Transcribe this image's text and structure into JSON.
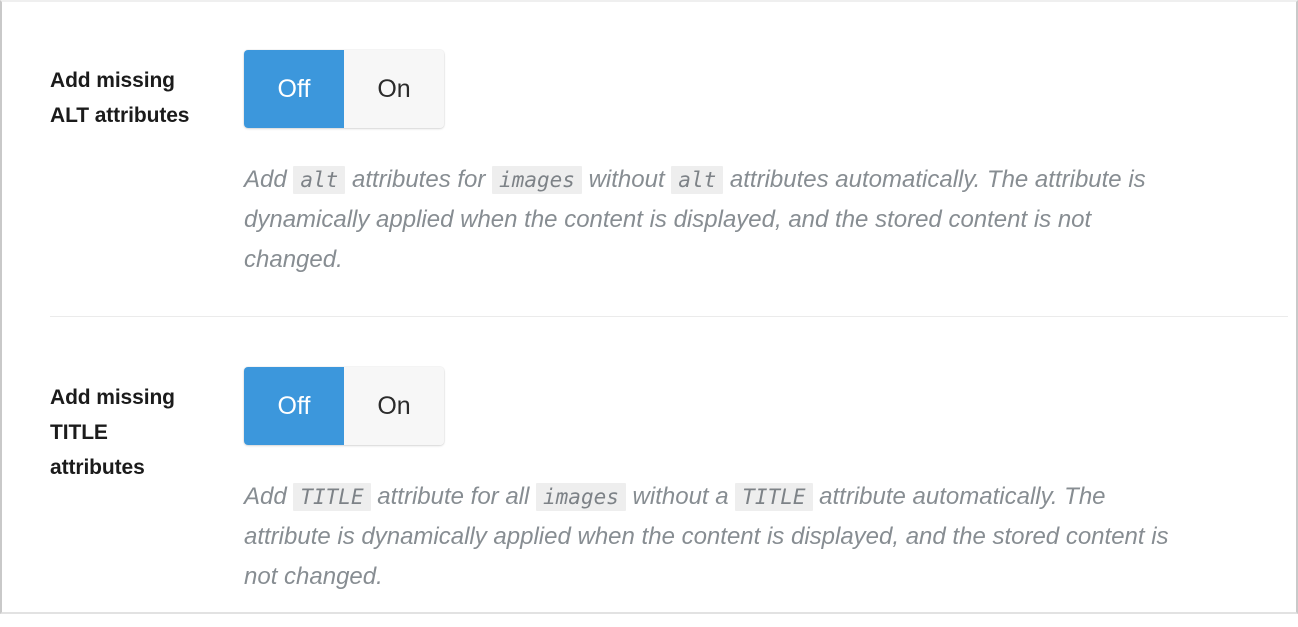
{
  "colors": {
    "accent": "#3c97dc",
    "accent_text": "#ffffff",
    "segment_inactive_bg": "#f7f7f7",
    "segment_inactive_text": "#2b2b2b",
    "label_text": "#1b1b1b",
    "description_text": "#878d92",
    "code_bg": "#eeeeee",
    "divider": "#ebebeb",
    "page_bg": "#ffffff"
  },
  "settings": [
    {
      "label": "Add missing ALT attributes",
      "toggle": {
        "off_label": "Off",
        "on_label": "On",
        "selected": "Off"
      },
      "description": {
        "parts": [
          {
            "type": "text",
            "value": "Add "
          },
          {
            "type": "code",
            "value": "alt"
          },
          {
            "type": "text",
            "value": " attributes for "
          },
          {
            "type": "code",
            "value": "images"
          },
          {
            "type": "text",
            "value": " without "
          },
          {
            "type": "code",
            "value": "alt"
          },
          {
            "type": "text",
            "value": " attributes automatically. The attribute is dynamically applied when the content is displayed, and the stored content is not changed."
          }
        ],
        "plain": "Add alt attributes for images without alt attributes automatically. The attribute is dynamically applied when the content is displayed, and the stored content is not changed."
      }
    },
    {
      "label": "Add missing TITLE attributes",
      "toggle": {
        "off_label": "Off",
        "on_label": "On",
        "selected": "Off"
      },
      "description": {
        "parts": [
          {
            "type": "text",
            "value": "Add "
          },
          {
            "type": "code",
            "value": "TITLE"
          },
          {
            "type": "text",
            "value": " attribute for all "
          },
          {
            "type": "code",
            "value": "images"
          },
          {
            "type": "text",
            "value": " without a "
          },
          {
            "type": "code",
            "value": "TITLE"
          },
          {
            "type": "text",
            "value": " attribute automatically. The attribute is dynamically applied when the content is displayed, and the stored content is not changed."
          }
        ],
        "plain": "Add TITLE attribute for all images without a TITLE attribute automatically. The attribute is dynamically applied when the content is displayed, and the stored content is not changed."
      }
    }
  ]
}
